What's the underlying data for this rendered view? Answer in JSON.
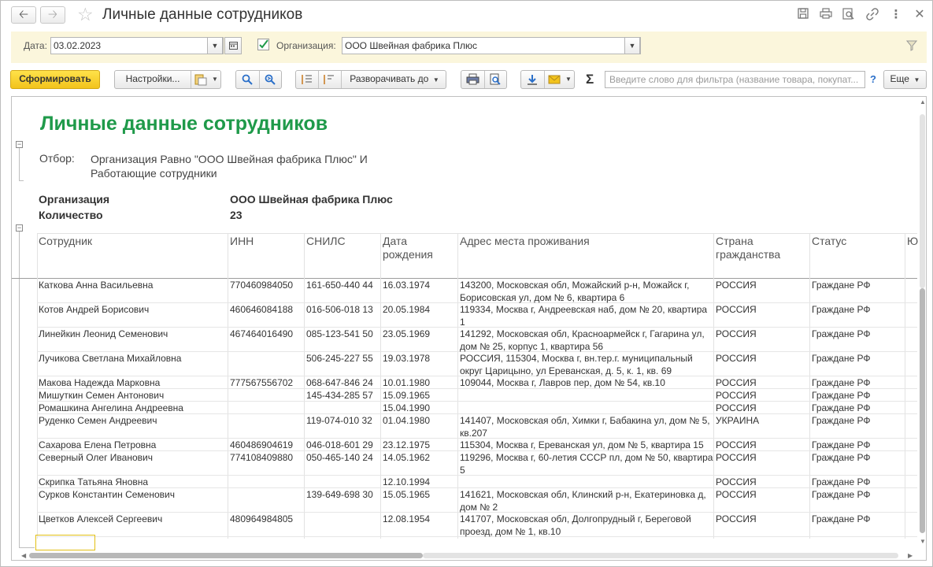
{
  "window": {
    "title": "Личные данные сотрудников",
    "nav_back_icon": "arrow-left-icon",
    "nav_forward_icon": "arrow-right-icon",
    "favorite_icon": "star-icon"
  },
  "params": {
    "date_label": "Дата:",
    "date_value": "03.02.2023",
    "org_checkbox_checked": true,
    "org_label": "Организация:",
    "org_value": "ООО Швейная фабрика Плюс"
  },
  "toolbar": {
    "generate_label": "Сформировать",
    "settings_label": "Настройки...",
    "expand_label": "Разворачивать до",
    "search_placeholder": "Введите слово для фильтра (название товара, покупат...",
    "help_label": "?",
    "more_label": "Еще",
    "sigma": "Σ"
  },
  "report": {
    "title": "Личные данные сотрудников",
    "filter_label": "Отбор:",
    "filter_text": "Организация Равно \"ООО Швейная фабрика Плюс\" И Работающие сотрудники",
    "org_key": "Организация",
    "org_val": "ООО Швейная фабрика Плюс",
    "count_key": "Количество",
    "count_val": "23",
    "columns": [
      "Сотрудник",
      "ИНН",
      "СНИЛС",
      "Дата рождения",
      "Адрес места проживания",
      "Страна гражданства",
      "Статус",
      "Ю"
    ],
    "rows": [
      {
        "name": "Каткова Анна Васильевна",
        "inn": "770460984050",
        "snils": "161-650-440 44",
        "birth": "16.03.1974",
        "address": "143200, Московская обл, Можайский р-н, Можайск г, Борисовская ул, дом № 6, квартира 6",
        "country": "РОССИЯ",
        "status": "Граждане РФ"
      },
      {
        "name": "Котов Андрей Борисович",
        "inn": "460646084188",
        "snils": "016-506-018 13",
        "birth": "20.05.1984",
        "address": "119334, Москва г, Андреевская наб, дом № 20, квартира 1",
        "country": "РОССИЯ",
        "status": "Граждане РФ"
      },
      {
        "name": "Линейкин Леонид Семенович",
        "inn": "467464016490",
        "snils": "085-123-541 50",
        "birth": "23.05.1969",
        "address": "141292, Московская обл, Красноармейск г, Гагарина ул, дом № 25, корпус 1, квартира 56",
        "country": "РОССИЯ",
        "status": "Граждане РФ"
      },
      {
        "name": "Лучикова Светлана Михайловна",
        "inn": "",
        "snils": "506-245-227 55",
        "birth": "19.03.1978",
        "address": "РОССИЯ, 115304, Москва г, вн.тер.г. муниципальный округ Царицыно, ул Ереванская, д. 5, к. 1, кв. 69",
        "country": "РОССИЯ",
        "status": "Граждане РФ"
      },
      {
        "name": "Макова Надежда Марковна",
        "inn": "777567556702",
        "snils": "068-647-846 24",
        "birth": "10.01.1980",
        "address": "109044, Москва г, Лавров пер, дом № 54, кв.10",
        "country": "РОССИЯ",
        "status": "Граждане РФ"
      },
      {
        "name": "Мишуткин Семен Антонович",
        "inn": "",
        "snils": "145-434-285 57",
        "birth": "15.09.1965",
        "address": "",
        "country": "РОССИЯ",
        "status": "Граждане РФ"
      },
      {
        "name": "Ромашкина Ангелина Андреевна",
        "inn": "",
        "snils": "",
        "birth": "15.04.1990",
        "address": "",
        "country": "РОССИЯ",
        "status": "Граждане РФ"
      },
      {
        "name": "Руденко Семен Андреевич",
        "inn": "",
        "snils": "119-074-010 32",
        "birth": "01.04.1980",
        "address": "141407, Московская обл, Химки г, Бабакина ул, дом № 5, кв.207",
        "country": "УКРАИНА",
        "status": "Граждане РФ"
      },
      {
        "name": "Сахарова Елена Петровна",
        "inn": "460486904619",
        "snils": "046-018-601 29",
        "birth": "23.12.1975",
        "address": "115304, Москва г, Ереванская ул, дом № 5, квартира 15",
        "country": "РОССИЯ",
        "status": "Граждане РФ"
      },
      {
        "name": "Северный Олег Иванович",
        "inn": "774108409880",
        "snils": "050-465-140 24",
        "birth": "14.05.1962",
        "address": "119296, Москва г, 60-летия СССР пл, дом № 50, квартира 5",
        "country": "РОССИЯ",
        "status": "Граждане РФ"
      },
      {
        "name": "Скрипка Татьяна Яновна",
        "inn": "",
        "snils": "",
        "birth": "12.10.1994",
        "address": "",
        "country": "РОССИЯ",
        "status": "Граждане РФ"
      },
      {
        "name": "Сурков Константин Семенович",
        "inn": "",
        "snils": "139-649-698 30",
        "birth": "15.05.1965",
        "address": "141621, Московская обл, Клинский р-н, Екатериновка д, дом № 2",
        "country": "РОССИЯ",
        "status": "Граждане РФ"
      },
      {
        "name": "Цветков Алексей Сергеевич",
        "inn": "480964984805",
        "snils": "",
        "birth": "12.08.1954",
        "address": "141707, Московская обл, Долгопрудный г, Береговой проезд, дом № 1, кв.10",
        "country": "РОССИЯ",
        "status": "Граждане РФ"
      }
    ]
  },
  "colors": {
    "accent_yellow": "#f2c31c",
    "title_green": "#1f9a4a",
    "param_bg": "#fbf6dc"
  }
}
